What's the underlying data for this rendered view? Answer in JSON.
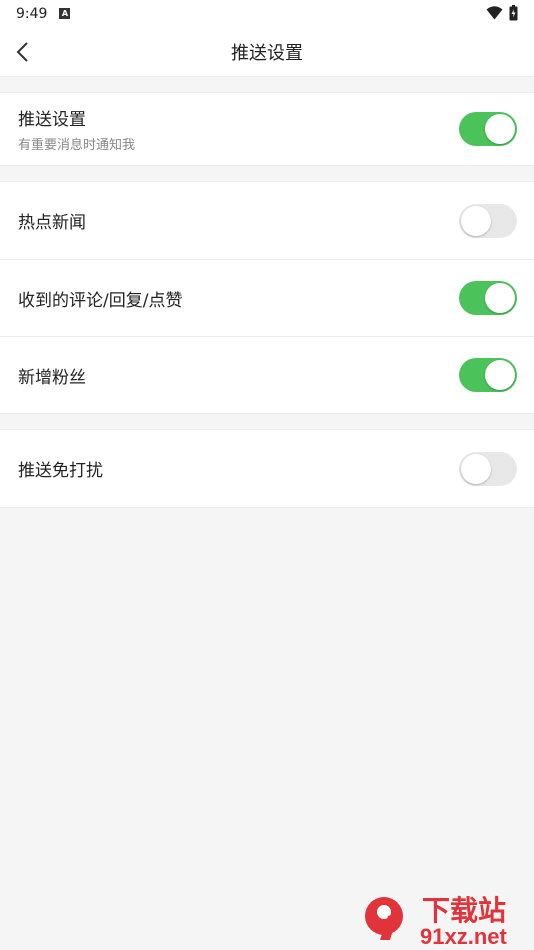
{
  "status_bar": {
    "time": "9:49",
    "notification_icon": "a-icon"
  },
  "header": {
    "title": "推送设置",
    "back_icon": "back-arrow-icon"
  },
  "groups": [
    {
      "rows": [
        {
          "label": "推送设置",
          "sublabel": "有重要消息时通知我",
          "enabled": true
        }
      ]
    },
    {
      "rows": [
        {
          "label": "热点新闻",
          "enabled": false
        },
        {
          "label": "收到的评论/回复/点赞",
          "enabled": true
        },
        {
          "label": "新增粉丝",
          "enabled": true
        }
      ]
    },
    {
      "rows": [
        {
          "label": "推送免打扰",
          "enabled": false
        }
      ]
    }
  ],
  "watermark": {
    "brand": "下载站",
    "url": "91xz.net"
  },
  "colors": {
    "toggle_on": "#4cc35a",
    "toggle_off": "#e8e8e8",
    "background": "#f5f5f5",
    "watermark_red": "#e0343a"
  }
}
